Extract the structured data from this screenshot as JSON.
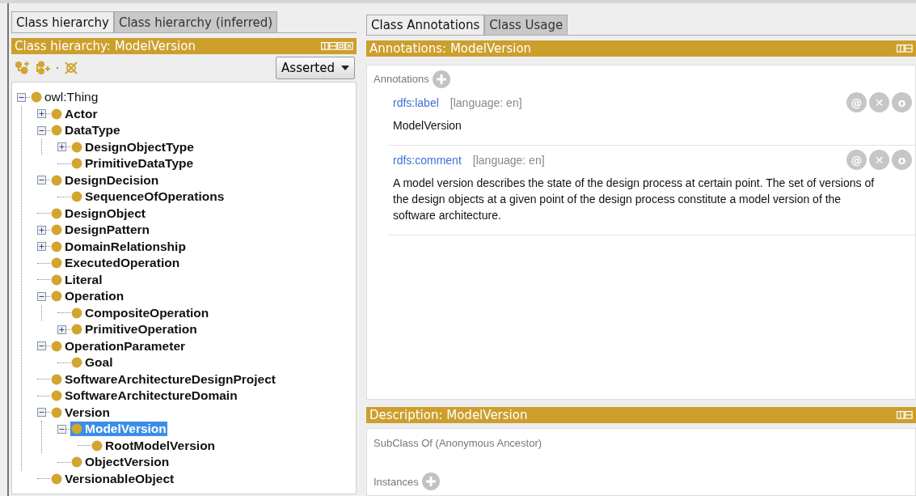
{
  "left_panel": {
    "tabs": [
      {
        "label": "Class hierarchy",
        "selected": true
      },
      {
        "label": "Class hierarchy (inferred)",
        "selected": false
      }
    ],
    "header": "Class hierarchy: ModelVersion",
    "mode_dropdown": "Asserted",
    "tree": [
      {
        "label": "owl:Thing",
        "bold": false,
        "selected": false,
        "has_children": true,
        "expanded": true,
        "children": [
          {
            "label": "Actor",
            "bold": true,
            "selected": false,
            "has_children": true,
            "expanded": false
          },
          {
            "label": "DataType",
            "bold": true,
            "selected": false,
            "has_children": true,
            "expanded": true,
            "children": [
              {
                "label": "DesignObjectType",
                "bold": true,
                "selected": false,
                "has_children": true,
                "expanded": false
              },
              {
                "label": "PrimitiveDataType",
                "bold": true,
                "selected": false,
                "has_children": false
              }
            ]
          },
          {
            "label": "DesignDecision",
            "bold": true,
            "selected": false,
            "has_children": true,
            "expanded": true,
            "children": [
              {
                "label": "SequenceOfOperations",
                "bold": true,
                "selected": false,
                "has_children": false
              }
            ]
          },
          {
            "label": "DesignObject",
            "bold": true,
            "selected": false,
            "has_children": false
          },
          {
            "label": "DesignPattern",
            "bold": true,
            "selected": false,
            "has_children": true,
            "expanded": false
          },
          {
            "label": "DomainRelationship",
            "bold": true,
            "selected": false,
            "has_children": true,
            "expanded": false
          },
          {
            "label": "ExecutedOperation",
            "bold": true,
            "selected": false,
            "has_children": false
          },
          {
            "label": "Literal",
            "bold": true,
            "selected": false,
            "has_children": false
          },
          {
            "label": "Operation",
            "bold": true,
            "selected": false,
            "has_children": true,
            "expanded": true,
            "children": [
              {
                "label": "CompositeOperation",
                "bold": true,
                "selected": false,
                "has_children": false
              },
              {
                "label": "PrimitiveOperation",
                "bold": true,
                "selected": false,
                "has_children": true,
                "expanded": false
              }
            ]
          },
          {
            "label": "OperationParameter",
            "bold": true,
            "selected": false,
            "has_children": true,
            "expanded": true,
            "children": [
              {
                "label": "Goal",
                "bold": true,
                "selected": false,
                "has_children": false
              }
            ]
          },
          {
            "label": "SoftwareArchitectureDesignProject",
            "bold": true,
            "selected": false,
            "has_children": false
          },
          {
            "label": "SoftwareArchitectureDomain",
            "bold": true,
            "selected": false,
            "has_children": false
          },
          {
            "label": "Version",
            "bold": true,
            "selected": false,
            "has_children": true,
            "expanded": true,
            "children": [
              {
                "label": "ModelVersion",
                "bold": true,
                "selected": true,
                "has_children": true,
                "expanded": true,
                "children": [
                  {
                    "label": "RootModelVersion",
                    "bold": true,
                    "selected": false,
                    "has_children": false
                  }
                ]
              },
              {
                "label": "ObjectVersion",
                "bold": true,
                "selected": false,
                "has_children": false
              }
            ]
          },
          {
            "label": "VersionableObject",
            "bold": true,
            "selected": false,
            "has_children": false
          }
        ]
      }
    ]
  },
  "right_panel": {
    "tabs": [
      {
        "label": "Class Annotations",
        "selected": true
      },
      {
        "label": "Class Usage",
        "selected": false
      }
    ],
    "annotations_header": "Annotations: ModelVersion",
    "annotations_label": "Annotations",
    "annotations": [
      {
        "property": "rdfs:label",
        "language": "[language: en]",
        "value": "ModelVersion",
        "actions": [
          "@",
          "✕",
          "o"
        ]
      },
      {
        "property": "rdfs:comment",
        "language": "[language: en]",
        "value": "A model version describes the state of the design process at certain point. The set of versions of the design objects at a given point of the design process constitute a model version of the software architecture.",
        "actions": [
          "@",
          "✕",
          "o"
        ]
      }
    ],
    "description_header": "Description: ModelVersion",
    "description_sections": [
      "SubClass Of (Anonymous Ancestor)",
      "Instances"
    ]
  }
}
